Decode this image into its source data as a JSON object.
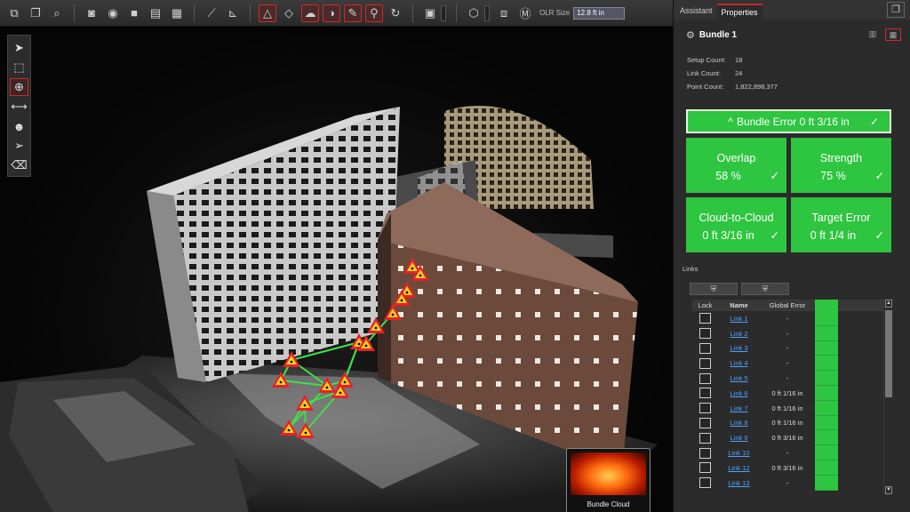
{
  "panel": {
    "tabs": [
      {
        "label": "Assistant"
      },
      {
        "label": "Properties"
      }
    ],
    "title": "Bundle 1",
    "stats": [
      {
        "label": "Setup Count:",
        "value": "18"
      },
      {
        "label": "Link Count:",
        "value": "24"
      },
      {
        "label": "Point Count:",
        "value": "1,822,898,377"
      }
    ],
    "bundle_error": {
      "label": "Bundle Error 0 ft 3/16 in",
      "status": "ok"
    },
    "tiles": [
      {
        "title": "Overlap",
        "value": "58 %"
      },
      {
        "title": "Strength",
        "value": "75 %"
      },
      {
        "title": "Cloud-to-Cloud",
        "value": "0 ft 3/16 in"
      },
      {
        "title": "Target Error",
        "value": "0 ft 1/4 in"
      }
    ],
    "links_label": "Links",
    "table": {
      "headers": {
        "lock": "Lock",
        "name": "Name",
        "error": "Global Error"
      },
      "rows": [
        {
          "name": "Link 1",
          "error": "-"
        },
        {
          "name": "Link 2",
          "error": "-"
        },
        {
          "name": "Link 3",
          "error": "-"
        },
        {
          "name": "Link 4",
          "error": "-"
        },
        {
          "name": "Link 5",
          "error": "-"
        },
        {
          "name": "Link 6",
          "error": "0 ft 1/16 in"
        },
        {
          "name": "Link 7",
          "error": "0 ft 1/16 in"
        },
        {
          "name": "Link 8",
          "error": "0 ft 1/16 in"
        },
        {
          "name": "Link 9",
          "error": "0 ft 3/16 in"
        },
        {
          "name": "Link 10",
          "error": "-"
        },
        {
          "name": "Link 12",
          "error": "0 ft 3/16 in"
        },
        {
          "name": "Link 13",
          "error": "-"
        }
      ]
    }
  },
  "toolbar": {
    "olr_label": "OLR Size",
    "olr_value": "12.8 ft in"
  },
  "viewport": {
    "minimap_label": "Bundle Cloud"
  },
  "colors": {
    "ok_green": "#2ec540",
    "active_red": "#d12a2a",
    "target_red": "#e8202a",
    "target_yellow": "#ffd21a",
    "link_green": "#3fe04a"
  }
}
